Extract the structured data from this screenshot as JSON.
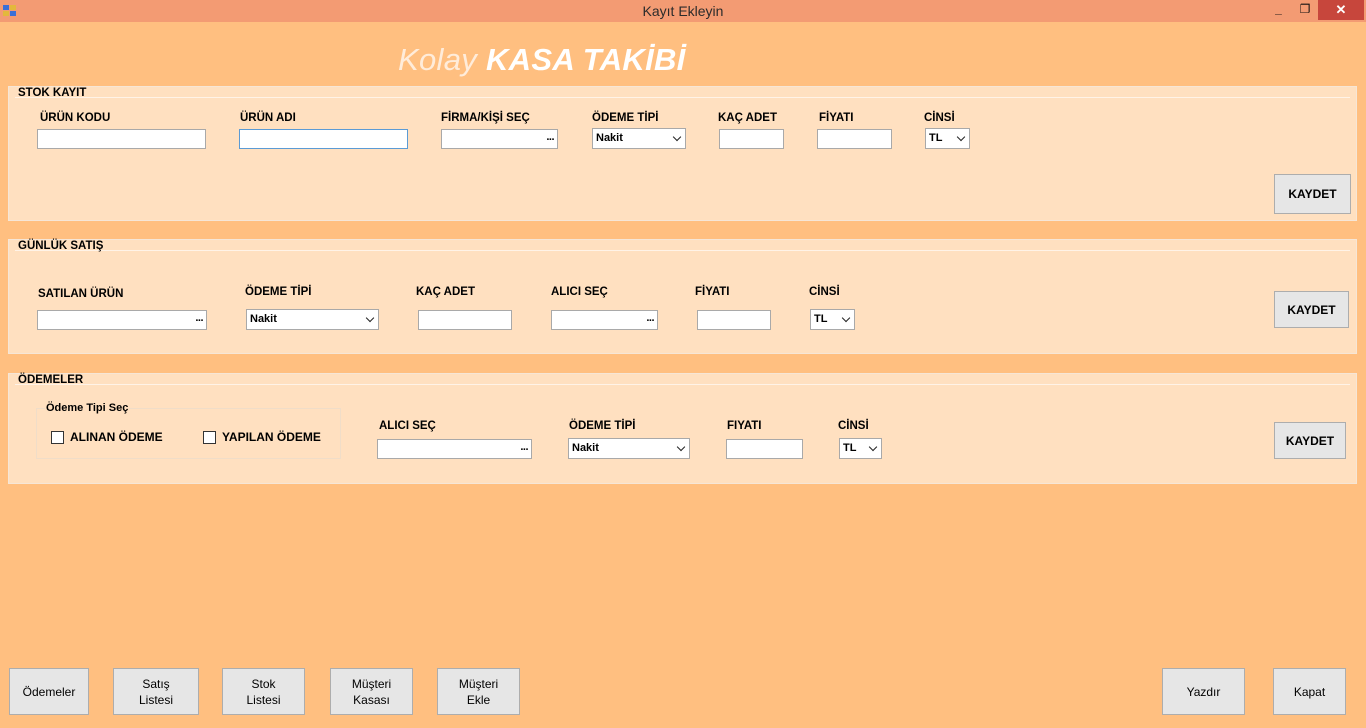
{
  "window": {
    "title": "Kayıt Ekleyin",
    "minimize": "_",
    "maximize": "❐",
    "close": "✕"
  },
  "brand": {
    "kolay": "Kolay",
    "kasa": "KASA TAKİBİ"
  },
  "stok_kayit": {
    "title": "STOK KAYIT",
    "labels": {
      "urun_kodu": "ÜRÜN KODU",
      "urun_adi": "ÜRÜN ADI",
      "firma": "FİRMA/KİŞİ SEÇ",
      "odeme_tipi": "ÖDEME TİPİ",
      "kac_adet": "KAÇ ADET",
      "fiyati": "FİYATI",
      "cinsi": "CİNSİ"
    },
    "values": {
      "urun_kodu": "",
      "urun_adi": "",
      "firma": "",
      "kac_adet": "",
      "fiyati": ""
    },
    "odeme_tipi": "Nakit",
    "cinsi": "TL",
    "picker_dots": "...",
    "save": "KAYDET"
  },
  "gunluk_satis": {
    "title": "GÜNLÜK SATIŞ",
    "labels": {
      "satilan_urun": "SATILAN ÜRÜN",
      "odeme_tipi": "ÖDEME TİPİ",
      "kac_adet": "KAÇ ADET",
      "alici": "ALICI SEÇ",
      "fiyati": "FİYATI",
      "cinsi": "CİNSİ"
    },
    "values": {
      "satilan_urun": "",
      "kac_adet": "",
      "alici": "",
      "fiyati": ""
    },
    "odeme_tipi": "Nakit",
    "cinsi": "TL",
    "picker_dots": "...",
    "save": "KAYDET"
  },
  "odemeler": {
    "title": "ÖDEMELER",
    "odeme_tipi_sec": "Ödeme Tipi Seç",
    "alinan": "ALINAN ÖDEME",
    "yapilan": "YAPILAN ÖDEME",
    "labels": {
      "alici": "ALICI SEÇ",
      "odeme_tipi": "ÖDEME TİPİ",
      "fiyati": "FIYATI",
      "cinsi": "CİNSİ"
    },
    "values": {
      "alici": "",
      "fiyati": ""
    },
    "odeme_tipi": "Nakit",
    "cinsi": "TL",
    "picker_dots": "...",
    "save": "KAYDET"
  },
  "bottom": {
    "odemeler": "Ödemeler",
    "satis_1": "Satış",
    "satis_2": "Listesi",
    "stok_1": "Stok",
    "stok_2": "Listesi",
    "musteri_kasasi_1": "Müşteri",
    "musteri_kasasi_2": "Kasası",
    "musteri_ekle_1": "Müşteri",
    "musteri_ekle_2": "Ekle",
    "yazdir": "Yazdır",
    "kapat": "Kapat"
  }
}
